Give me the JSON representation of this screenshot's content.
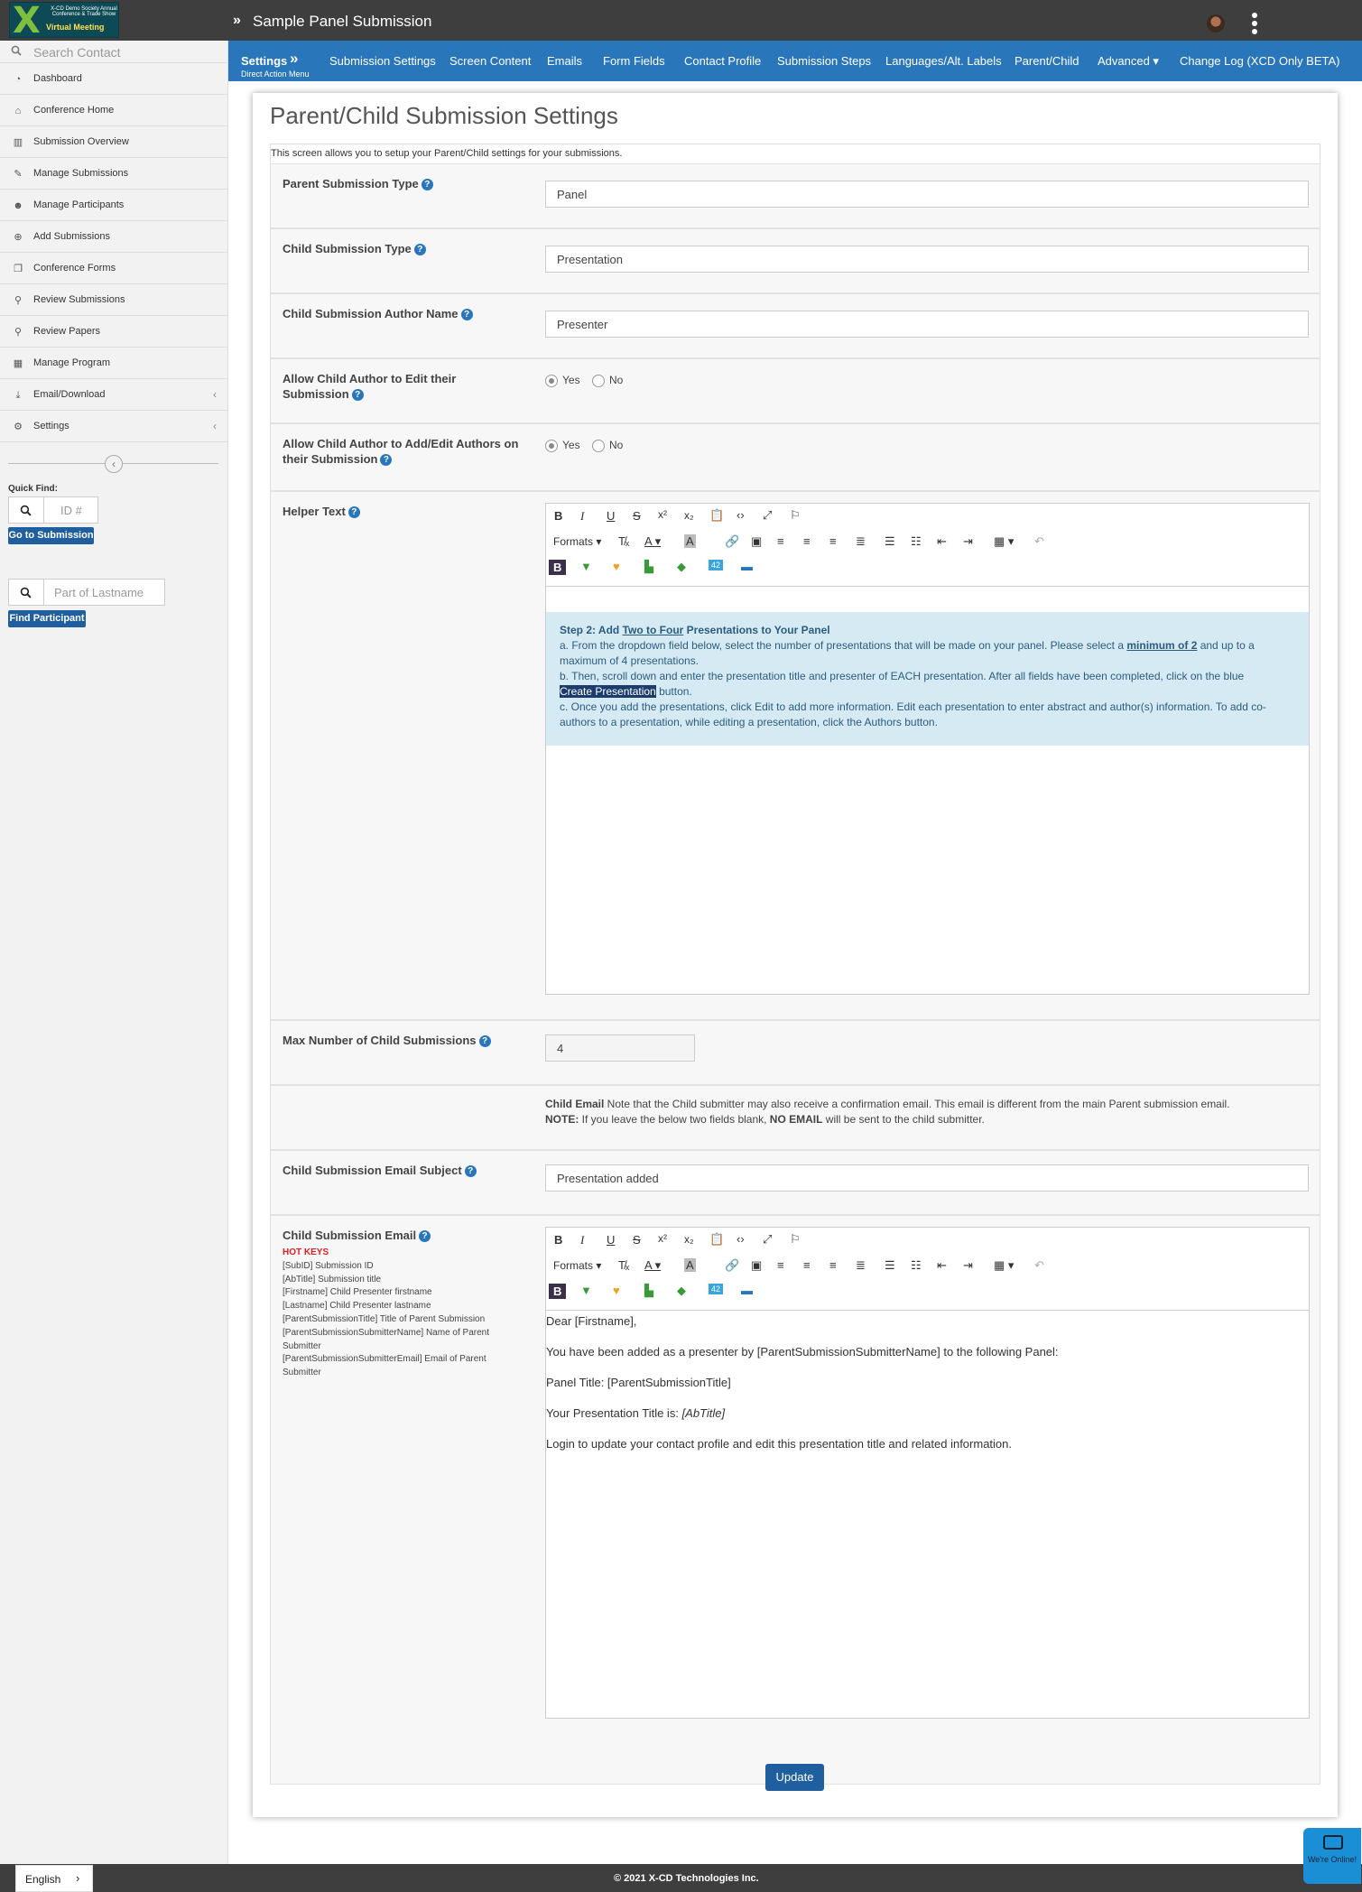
{
  "header": {
    "logo": {
      "line1": "X-CD Demo Society Annual Conference & Trade Show",
      "line2": "Virtual Meeting"
    },
    "title": "Sample Panel Submission"
  },
  "sidebar": {
    "search_placeholder": "Search Contact",
    "items": [
      {
        "label": "Dashboard",
        "icon": "dashboard-icon"
      },
      {
        "label": "Conference Home",
        "icon": "home-icon"
      },
      {
        "label": "Submission Overview",
        "icon": "bar-chart-icon"
      },
      {
        "label": "Manage Submissions",
        "icon": "edit-icon"
      },
      {
        "label": "Manage Participants",
        "icon": "users-icon"
      },
      {
        "label": "Add Submissions",
        "icon": "plus-circle-icon"
      },
      {
        "label": "Conference Forms",
        "icon": "copy-icon"
      },
      {
        "label": "Review Submissions",
        "icon": "search-icon"
      },
      {
        "label": "Review Papers",
        "icon": "search-icon"
      },
      {
        "label": "Manage Program",
        "icon": "calendar-icon"
      },
      {
        "label": "Email/Download",
        "icon": "download-icon"
      },
      {
        "label": "Settings",
        "icon": "cogs-icon"
      }
    ],
    "quick_find_label": "Quick Find:",
    "id_placeholder": "ID #",
    "go_button": "Go to Submission",
    "lastname_placeholder": "Part of Lastname",
    "find_button": "Find Participant"
  },
  "nav": {
    "settings": "Settings",
    "direct_action": "Direct Action Menu",
    "tabs": [
      "Submission Settings",
      "Screen Content",
      "Emails",
      "Form Fields",
      "Contact Profile",
      "Submission Steps",
      "Languages/Alt. Labels",
      "Parent/Child",
      "Advanced ▾",
      "Change Log (XCD Only BETA)"
    ]
  },
  "page": {
    "title": "Parent/Child Submission Settings",
    "intro": "This screen allows you to setup your Parent/Child settings for your submissions.",
    "parent_type": {
      "label": "Parent Submission Type",
      "value": "Panel"
    },
    "child_type": {
      "label": "Child Submission Type",
      "value": "Presentation"
    },
    "child_author": {
      "label": "Child Submission Author Name",
      "value": "Presenter"
    },
    "allow_edit": {
      "label": "Allow Child Author to Edit their Submission",
      "yes": "Yes",
      "no": "No",
      "selected": "Yes"
    },
    "allow_add": {
      "label": "Allow Child Author to Add/Edit Authors on their Submission",
      "yes": "Yes",
      "no": "No",
      "selected": "Yes"
    },
    "helper": {
      "label": "Helper Text",
      "step_prefix": "Step 2: Add ",
      "step_link": "Two to Four",
      "step_suffix": " Presentations to Your Panel",
      "a_prefix": "a. From the dropdown field below, select the number of presentations that will be made on your panel. Please select a ",
      "a_bold": "minimum of 2",
      "a_suffix": " and up to a maximum of 4 presentations.",
      "b_text": "b. Then, scroll down and enter the presentation title and presenter of EACH presentation. After all fields have been completed, click on the blue",
      "b_highlight": "Create Presentation",
      "b_suffix": " button.",
      "c_text": "c. Once you add the presentations, click Edit to add more information. Edit each presentation to enter abstract and author(s) information. To add co-authors to a presentation, while editing a presentation, click the Authors button."
    },
    "max_children": {
      "label": "Max Number of Child Submissions",
      "value": "4"
    },
    "child_email_note": {
      "bold1": "Child Email",
      "text1": " Note that the Child submitter may also receive a confirmation email. This email is different from the main Parent submission email.",
      "bold2": "NOTE:",
      "text2": " If you leave the below two fields blank, ",
      "bold3": "NO EMAIL",
      "text3": " will be sent to the child submitter."
    },
    "email_subject": {
      "label": "Child Submission Email Subject",
      "value": "Presentation added"
    },
    "email_body": {
      "label": "Child Submission Email",
      "hot_keys_title": "HOT KEYS",
      "hot_keys": [
        "[SubID] Submission ID",
        "[AbTitle] Submission title",
        "[Firstname] Child Presenter firstname",
        "[Lastname] Child Presenter lastname",
        "[ParentSubmissionTitle] Title of Parent Submission",
        "[ParentSubmissionSubmitterName] Name of Parent Submitter",
        "[ParentSubmissionSubmitterEmail] Email of Parent Submitter"
      ],
      "lines": [
        "Dear [Firstname],",
        "You have been added as a presenter by [ParentSubmissionSubmitterName] to the following Panel:",
        "Panel Title: [ParentSubmissionTitle]",
        "Your Presentation Title is: ",
        "Login to update your contact profile and edit this presentation title and related information."
      ],
      "abtitle": "[AbTitle]"
    },
    "update_button": "Update"
  },
  "editor_toolbar": {
    "formats": "Formats"
  },
  "footer": {
    "copyright": "© 2021 X-CD Technologies Inc.",
    "language": "English",
    "chat": "We're Online!"
  }
}
